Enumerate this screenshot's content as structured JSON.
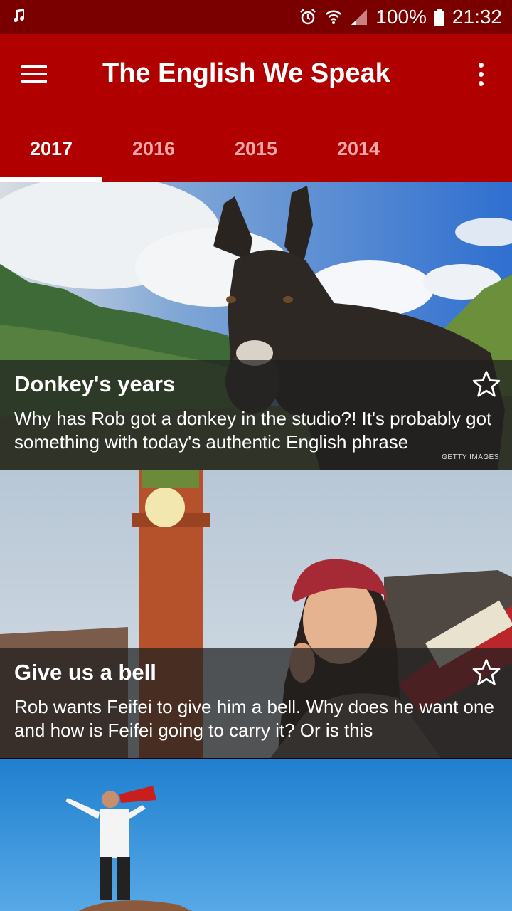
{
  "status_bar": {
    "battery": "100%",
    "time": "21:32"
  },
  "app_bar": {
    "title": "The English We Speak"
  },
  "tabs": [
    {
      "label": "2017",
      "active": true
    },
    {
      "label": "2016",
      "active": false
    },
    {
      "label": "2015",
      "active": false
    },
    {
      "label": "2014",
      "active": false
    }
  ],
  "episodes": [
    {
      "title": "Donkey's years",
      "description": "Why has Rob got a donkey in the studio?! It's probably got something with today's authentic English phrase",
      "image_credit": "GETTY IMAGES",
      "icon": "star-outline-icon"
    },
    {
      "title": "Give us a bell",
      "description": "Rob wants Feifei to give him a bell. Why does he want one and how is Feifei going to carry it? Or is this",
      "icon": "star-outline-icon"
    }
  ],
  "colors": {
    "app_bar": "#b00000",
    "status_bar": "#7a0000",
    "tab_inactive": "#f2a8a8"
  }
}
